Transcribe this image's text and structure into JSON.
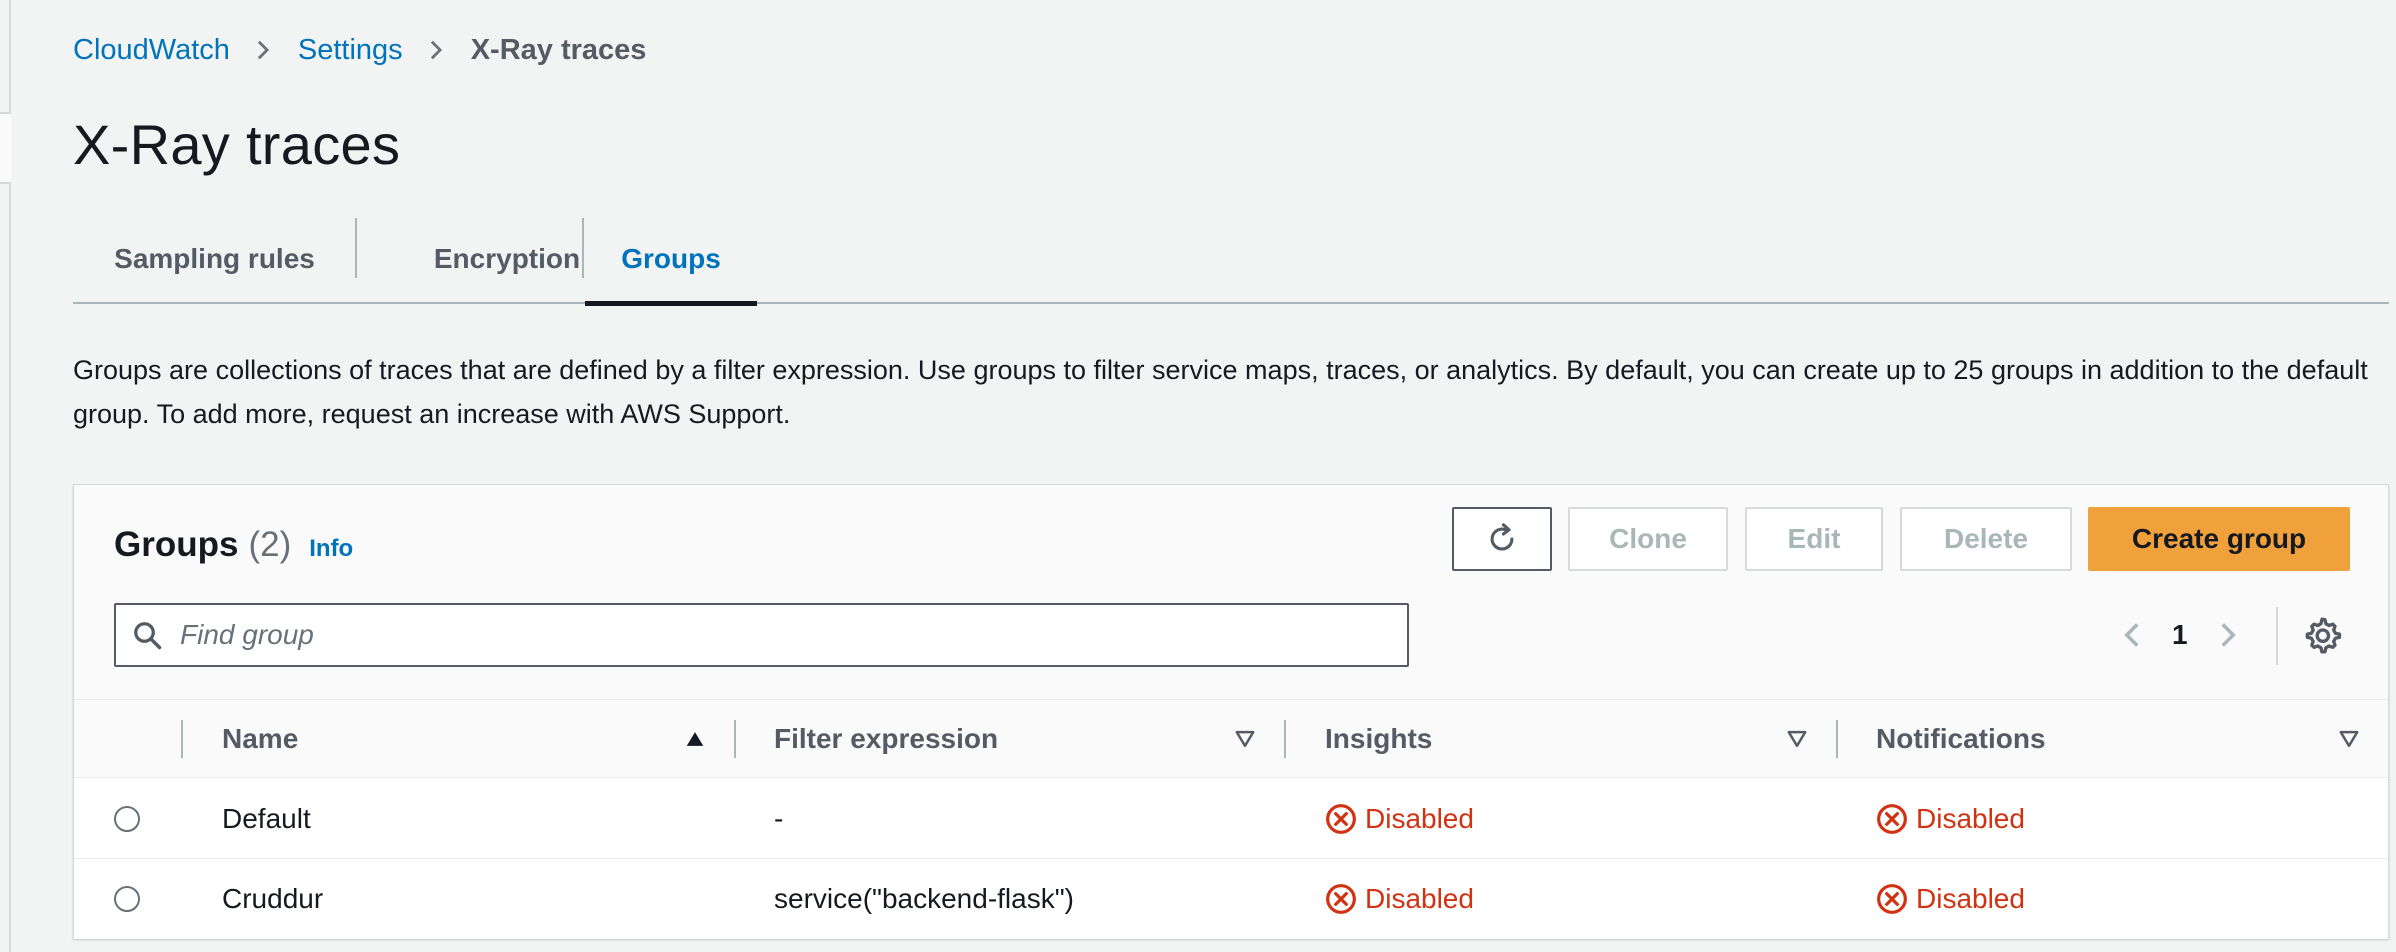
{
  "breadcrumb": {
    "items": [
      "CloudWatch",
      "Settings"
    ],
    "current": "X-Ray traces"
  },
  "page": {
    "title": "X-Ray traces",
    "description": "Groups are collections of traces that are defined by a filter expression. Use groups to filter service maps, traces, or analytics. By default, you can create up to 25 groups in addition to the default group. To add more, request an increase with AWS Support."
  },
  "tabs": [
    {
      "label": "Sampling rules",
      "active": false
    },
    {
      "label": "Encryption",
      "active": false
    },
    {
      "label": "Groups",
      "active": true
    }
  ],
  "groups_panel": {
    "title": "Groups",
    "count": "(2)",
    "info_label": "Info",
    "buttons": {
      "refresh_icon": "refresh-icon",
      "clone": "Clone",
      "edit": "Edit",
      "delete": "Delete",
      "create": "Create group"
    },
    "search": {
      "placeholder": "Find group",
      "value": ""
    },
    "pagination": {
      "current_page": "1"
    },
    "columns": [
      "Name",
      "Filter expression",
      "Insights",
      "Notifications"
    ],
    "sort": {
      "column": "Name",
      "direction": "ascending"
    },
    "rows": [
      {
        "name": "Default",
        "filter": "-",
        "insights": "Disabled",
        "notifications": "Disabled"
      },
      {
        "name": "Cruddur",
        "filter": "service(\"backend-flask\")",
        "insights": "Disabled",
        "notifications": "Disabled"
      }
    ]
  },
  "colors": {
    "link": "#0073bb",
    "primary_button": "#f0a13c",
    "error": "#d13212",
    "text": "#16191f",
    "muted": "#545b64"
  }
}
